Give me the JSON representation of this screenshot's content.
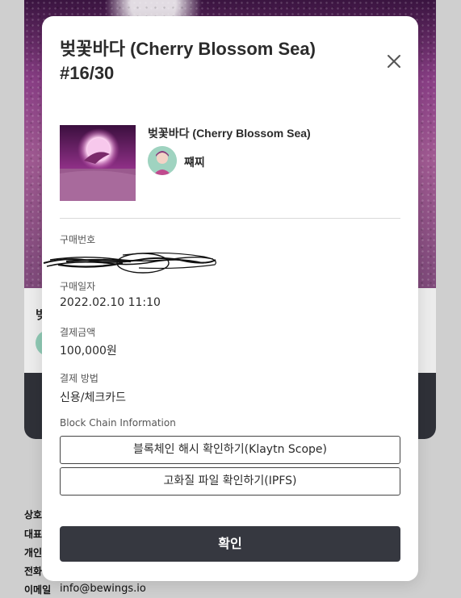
{
  "background": {
    "card_title_fragment": "벚",
    "footer_labels": [
      "상호",
      "대표",
      "개인",
      "전화",
      "이메일"
    ],
    "footer_email": "info@bewings.io"
  },
  "modal": {
    "title_line1": "벚꽃바다 (Cherry Blossom Sea)",
    "title_line2": "#16/30",
    "close_icon": "close-icon",
    "item": {
      "thumbnail": "artwork-thumbnail",
      "name": "벚꽃바다 (Cherry Blossom Sea)",
      "creator_avatar": "creator-avatar",
      "creator": "쨰찌"
    },
    "fields": {
      "order_number_label": "구매번호",
      "purchase_date_label": "구매일자",
      "purchase_date": "2022.02.10 11:10",
      "amount_label": "결제금액",
      "amount": "100,000원",
      "payment_method_label": "결제 방법",
      "payment_method": "신용/체크카드"
    },
    "blockchain": {
      "section_label": "Block Chain Information",
      "hash_button": "블록체인 해시 확인하기(Klaytn Scope)",
      "ipfs_button": "고화질 파일 확인하기(IPFS)"
    },
    "confirm_button": "확인"
  },
  "colors": {
    "backdrop": "#cfcfcf",
    "modal_bg": "#ffffff",
    "primary_button": "#363840",
    "text": "#2b2b2b",
    "muted_text": "#555555"
  }
}
